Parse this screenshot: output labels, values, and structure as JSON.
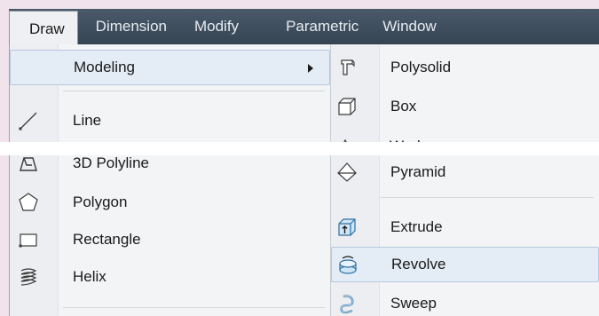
{
  "menubar": {
    "items": [
      {
        "label": "Draw",
        "active": true
      },
      {
        "label": "Dimension"
      },
      {
        "label": "Modify"
      },
      {
        "label": "Parametric"
      },
      {
        "label": "Window"
      }
    ]
  },
  "draw_menu": {
    "items": [
      {
        "label": "Modeling",
        "icon": "none",
        "has_submenu": true,
        "highlighted": true
      },
      {
        "label": "Line",
        "icon": "line-icon"
      },
      {
        "label": "3D Polyline",
        "icon": "3d-polyline-icon"
      },
      {
        "label": "Polygon",
        "icon": "polygon-icon"
      },
      {
        "label": "Rectangle",
        "icon": "rectangle-icon"
      },
      {
        "label": "Helix",
        "icon": "helix-icon"
      }
    ]
  },
  "modeling_submenu": {
    "items": [
      {
        "label": "Polysolid",
        "icon": "polysolid-icon"
      },
      {
        "label": "Box",
        "icon": "box-icon"
      },
      {
        "label": "Wedge",
        "icon": "wedge-icon",
        "partially_hidden": true
      },
      {
        "label": "Pyramid",
        "icon": "pyramid-icon"
      },
      {
        "label": "Extrude",
        "icon": "extrude-icon"
      },
      {
        "label": "Revolve",
        "icon": "revolve-icon",
        "highlighted": true
      },
      {
        "label": "Sweep",
        "icon": "sweep-icon"
      }
    ]
  },
  "colors": {
    "menubar": "#3d4d5e",
    "highlight": "#e4ecf6",
    "background": "#f0e3eb"
  }
}
